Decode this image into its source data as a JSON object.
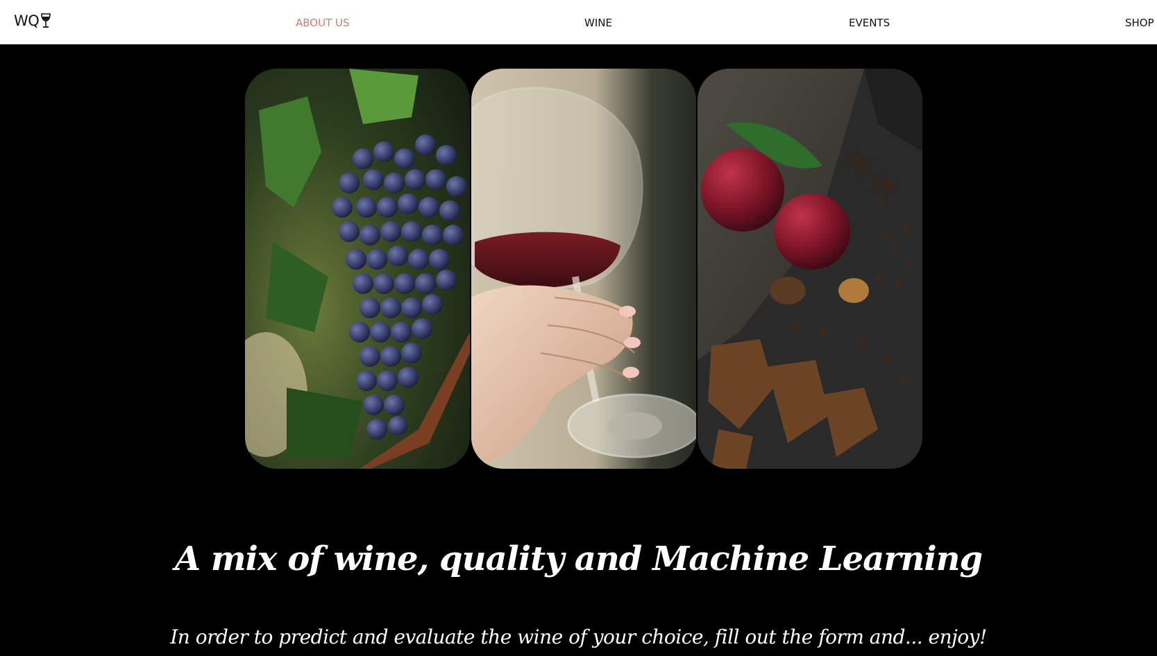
{
  "brand": {
    "logo_text": "WQ",
    "logo_icon": "wine-glass-icon"
  },
  "nav": {
    "items": [
      {
        "label": "ABOUT US",
        "active": true
      },
      {
        "label": "WINE",
        "active": false
      },
      {
        "label": "EVENTS",
        "active": false
      },
      {
        "label": "SHOP",
        "active": false
      }
    ]
  },
  "gallery": {
    "images": [
      {
        "subject": "grapes-image"
      },
      {
        "subject": "wine-glass-image"
      },
      {
        "subject": "plums-spices-image"
      }
    ]
  },
  "hero": {
    "headline": "A mix of wine, quality and Machine Learning",
    "subline": "In order to predict and evaluate the wine of your choice, fill out the form and... enjoy!"
  },
  "colors": {
    "accent": "#d57a76",
    "background": "#000000",
    "navbar": "#ffffff"
  }
}
